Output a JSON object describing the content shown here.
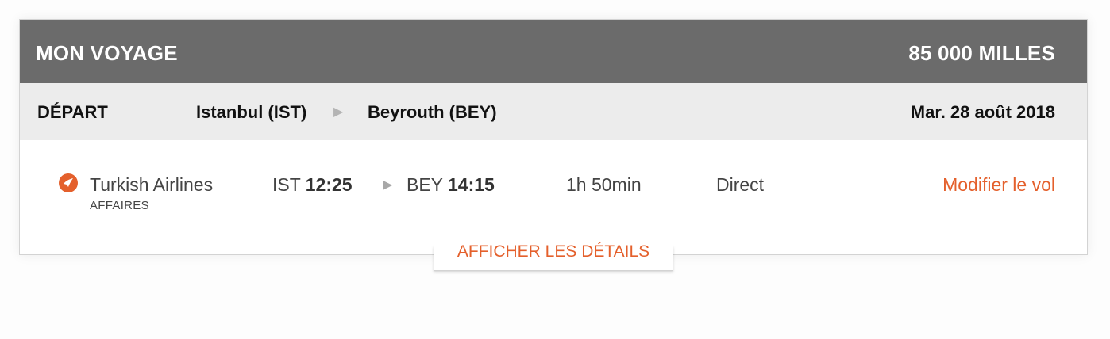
{
  "header": {
    "title": "MON VOYAGE",
    "miles": "85 000 MILLES"
  },
  "route": {
    "label": "DÉPART",
    "origin": "Istanbul (IST)",
    "destination": "Beyrouth (BEY)",
    "date": "Mar. 28 août 2018"
  },
  "flight": {
    "airline": "Turkish Airlines",
    "cabin": "AFFAIRES",
    "dep_code": "IST",
    "dep_time": "12:25",
    "arr_code": "BEY",
    "arr_time": "14:15",
    "duration": "1h 50min",
    "stops": "Direct",
    "modify_label": "Modifier le vol"
  },
  "details_label": "AFFICHER LES DÉTAILS",
  "icons": {
    "airline_logo": "turkish-airlines-logo-icon",
    "route_arrow": "chevron-right-icon"
  },
  "colors": {
    "accent": "#e4602c",
    "header_bg": "#6b6b6b",
    "route_bg": "#ececec"
  }
}
